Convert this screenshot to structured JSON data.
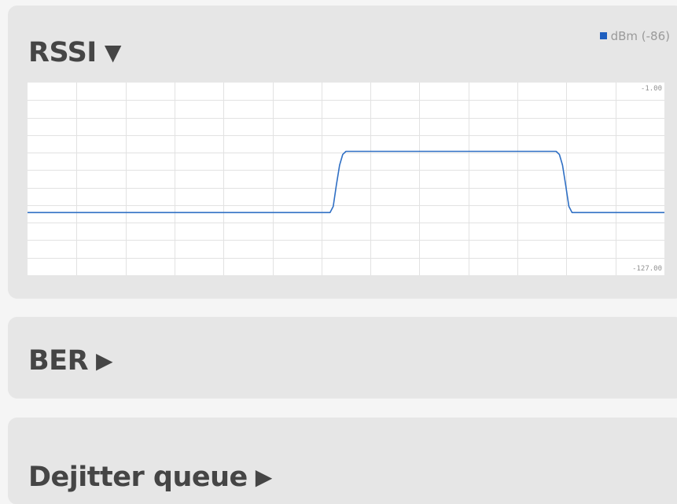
{
  "panels": {
    "rssi": {
      "title": "RSSI",
      "arrow": "▼"
    },
    "ber": {
      "title": "BER",
      "arrow": "▶"
    },
    "dejitter": {
      "title": "Dejitter queue",
      "arrow": "▶"
    }
  },
  "legend": {
    "label": "dBm (-86)",
    "color": "#1f5fbf"
  },
  "chart_data": {
    "type": "line",
    "ylim": [
      -127,
      -1
    ],
    "y_tick_labels": [
      "-1.00",
      "-127.00"
    ],
    "grid": true,
    "series": [
      {
        "name": "dBm",
        "color": "#2f6fc4",
        "x": [
          0,
          0.475,
          0.48,
          0.485,
          0.49,
          0.495,
          0.5,
          0.83,
          0.835,
          0.84,
          0.845,
          0.85,
          0.855,
          1.0
        ],
        "y": [
          -86,
          -86,
          -82,
          -68,
          -55,
          -48,
          -46,
          -46,
          -48,
          -55,
          -68,
          -82,
          -86,
          -86
        ]
      }
    ]
  }
}
